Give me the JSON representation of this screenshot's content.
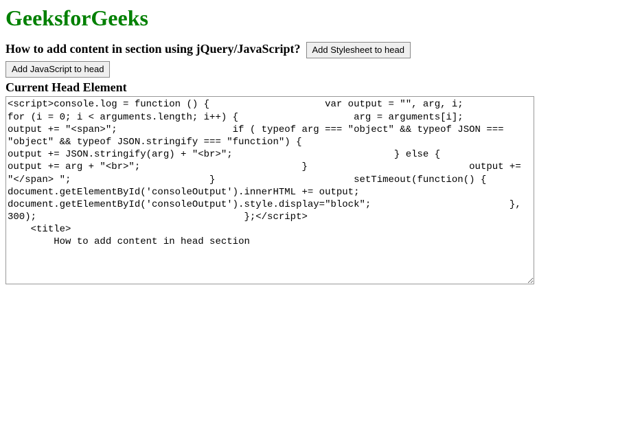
{
  "heading": "GeeksforGeeks",
  "question": "How to add content in section using jQuery/JavaScript?",
  "buttons": {
    "add_stylesheet": "Add Stylesheet to head",
    "add_javascript": "Add JavaScript to head"
  },
  "subheading": "Current Head Element",
  "textarea_content": "<script>console.log = function () {                    var output = \"\", arg, i;                        for (i = 0; i < arguments.length; i++) {                    arg = arguments[i];                            output += \"<span>\";                    if ( typeof arg === \"object\" && typeof JSON === \"object\" && typeof JSON.stringify === \"function\") {                                        output += JSON.stringify(arg) + \"<br>\";                            } else {                                output += arg + \"<br>\";                            }                            output += \"</span> \";                        }                        setTimeout(function() {                            document.getElementById('consoleOutput').innerHTML += output;                        document.getElementById('consoleOutput').style.display=\"block\";                        }, 300);                                    };</script>\n    <title>\n        How to add content in head section"
}
